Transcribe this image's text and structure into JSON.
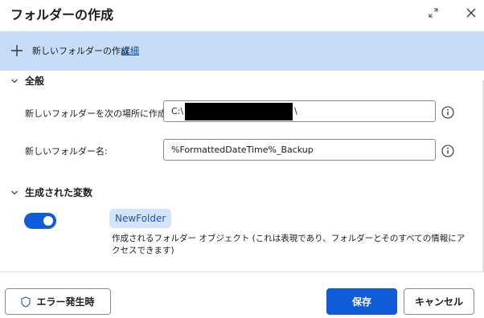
{
  "dialog": {
    "title": "フォルダーの作成"
  },
  "banner": {
    "text": "新しいフォルダーの作成",
    "link": "詳細"
  },
  "general": {
    "heading": "全般",
    "parent_folder": {
      "label": "新しいフォルダーを次の場所に作成:",
      "value_prefix": "C:\\",
      "value_suffix": "\\"
    },
    "folder_name": {
      "label": "新しいフォルダー名:",
      "value": "%FormattedDateTime%_Backup"
    }
  },
  "variables": {
    "heading": "生成された変数",
    "toggle_on": true,
    "variable_name": "NewFolder",
    "description": "作成されるフォルダー オブジェクト (これは表現であり、フォルダーとそのすべての情報にアクセスできます)"
  },
  "footer": {
    "on_error_label": "エラー発生時",
    "save_label": "保存",
    "cancel_label": "キャンセル"
  },
  "colors": {
    "accent": "#0f5bd8",
    "banner_bg": "#c7dcf7",
    "chip_bg": "#d4e5fb",
    "link": "#0f4ea8"
  },
  "icons": {
    "expand": "expand-icon",
    "close": "close-icon",
    "add": "plus-icon",
    "section_toggle": "chevron-down-icon",
    "info": "info-icon",
    "shield": "shield-icon"
  }
}
